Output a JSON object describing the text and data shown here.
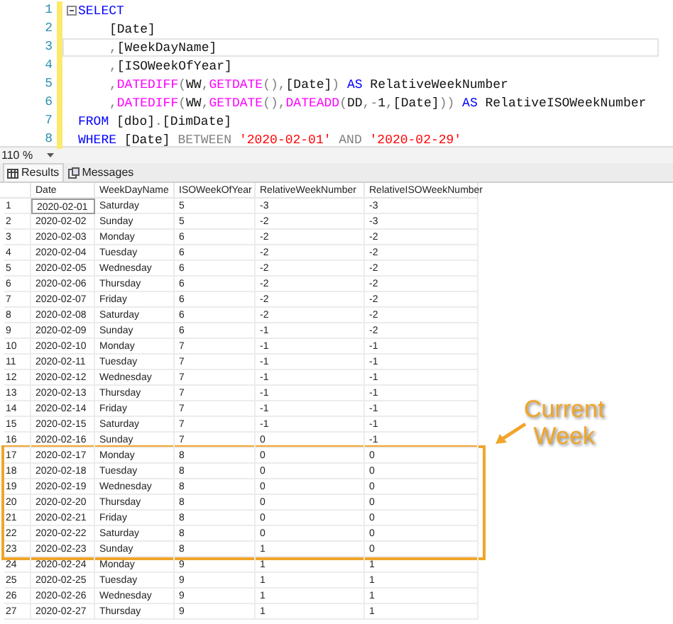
{
  "editor": {
    "lines": [
      {
        "number": "1",
        "collapsible": true,
        "indent": false,
        "current": false,
        "tokens": [
          {
            "kind": "kw",
            "text": "SELECT"
          }
        ]
      },
      {
        "number": "2",
        "collapsible": false,
        "indent": true,
        "current": false,
        "tokens": [
          {
            "kind": "id",
            "text": "[Date]"
          }
        ]
      },
      {
        "number": "3",
        "collapsible": false,
        "indent": true,
        "current": true,
        "tokens": [
          {
            "kind": "op",
            "text": ","
          },
          {
            "kind": "id",
            "text": "[WeekDayName]"
          }
        ]
      },
      {
        "number": "4",
        "collapsible": false,
        "indent": true,
        "current": false,
        "tokens": [
          {
            "kind": "op",
            "text": ","
          },
          {
            "kind": "id",
            "text": "[ISOWeekOfYear]"
          }
        ]
      },
      {
        "number": "5",
        "collapsible": false,
        "indent": true,
        "current": false,
        "tokens": [
          {
            "kind": "op",
            "text": ","
          },
          {
            "kind": "fn",
            "text": "DATEDIFF"
          },
          {
            "kind": "op",
            "text": "("
          },
          {
            "kind": "id",
            "text": "WW"
          },
          {
            "kind": "op",
            "text": ","
          },
          {
            "kind": "fn",
            "text": "GETDATE"
          },
          {
            "kind": "op",
            "text": "(),"
          },
          {
            "kind": "id",
            "text": "[Date]"
          },
          {
            "kind": "op",
            "text": ")"
          },
          {
            "kind": "kw",
            "text": " AS"
          },
          {
            "kind": "id",
            "text": " RelativeWeekNumber"
          }
        ]
      },
      {
        "number": "6",
        "collapsible": false,
        "indent": true,
        "current": false,
        "tokens": [
          {
            "kind": "op",
            "text": ","
          },
          {
            "kind": "fn",
            "text": "DATEDIFF"
          },
          {
            "kind": "op",
            "text": "("
          },
          {
            "kind": "id",
            "text": "WW"
          },
          {
            "kind": "op",
            "text": ","
          },
          {
            "kind": "fn",
            "text": "GETDATE"
          },
          {
            "kind": "op",
            "text": "(),"
          },
          {
            "kind": "fn",
            "text": "DATEADD"
          },
          {
            "kind": "op",
            "text": "("
          },
          {
            "kind": "id",
            "text": "DD"
          },
          {
            "kind": "op",
            "text": ",-"
          },
          {
            "kind": "id",
            "text": "1"
          },
          {
            "kind": "op",
            "text": ","
          },
          {
            "kind": "id",
            "text": "[Date]"
          },
          {
            "kind": "op",
            "text": "))"
          },
          {
            "kind": "kw",
            "text": " AS"
          },
          {
            "kind": "id",
            "text": " RelativeISOWeekNumber"
          }
        ]
      },
      {
        "number": "7",
        "collapsible": false,
        "indent": false,
        "current": false,
        "tokens": [
          {
            "kind": "kw",
            "text": "FROM"
          },
          {
            "kind": "id",
            "text": " [dbo]"
          },
          {
            "kind": "op",
            "text": "."
          },
          {
            "kind": "id",
            "text": "[DimDate]"
          }
        ]
      },
      {
        "number": "8",
        "collapsible": false,
        "indent": false,
        "current": false,
        "tokens": [
          {
            "kind": "kw",
            "text": "WHERE"
          },
          {
            "kind": "id",
            "text": " [Date]"
          },
          {
            "kind": "op",
            "text": " BETWEEN "
          },
          {
            "kind": "str",
            "text": "'2020-02-01'"
          },
          {
            "kind": "op",
            "text": " AND "
          },
          {
            "kind": "str",
            "text": "'2020-02-29'"
          }
        ]
      }
    ]
  },
  "zoom": {
    "value": "110 %"
  },
  "tabs": [
    {
      "label": "Results",
      "kind": "grid",
      "selected": true
    },
    {
      "label": "Messages",
      "kind": "messages",
      "selected": false
    }
  ],
  "results": {
    "columns": [
      "Date",
      "WeekDayName",
      "ISOWeekOfYear",
      "RelativeWeekNumber",
      "RelativeISOWeekNumber"
    ],
    "rows": [
      {
        "number": "1",
        "cells": [
          "2020-02-01",
          "Saturday",
          "5",
          "-3",
          "-3"
        ],
        "focused": true,
        "boxed": false
      },
      {
        "number": "2",
        "cells": [
          "2020-02-02",
          "Sunday",
          "5",
          "-2",
          "-3"
        ],
        "focused": false,
        "boxed": false
      },
      {
        "number": "3",
        "cells": [
          "2020-02-03",
          "Monday",
          "6",
          "-2",
          "-2"
        ],
        "focused": false,
        "boxed": false
      },
      {
        "number": "4",
        "cells": [
          "2020-02-04",
          "Tuesday",
          "6",
          "-2",
          "-2"
        ],
        "focused": false,
        "boxed": false
      },
      {
        "number": "5",
        "cells": [
          "2020-02-05",
          "Wednesday",
          "6",
          "-2",
          "-2"
        ],
        "focused": false,
        "boxed": false
      },
      {
        "number": "6",
        "cells": [
          "2020-02-06",
          "Thursday",
          "6",
          "-2",
          "-2"
        ],
        "focused": false,
        "boxed": false
      },
      {
        "number": "7",
        "cells": [
          "2020-02-07",
          "Friday",
          "6",
          "-2",
          "-2"
        ],
        "focused": false,
        "boxed": false
      },
      {
        "number": "8",
        "cells": [
          "2020-02-08",
          "Saturday",
          "6",
          "-2",
          "-2"
        ],
        "focused": false,
        "boxed": false
      },
      {
        "number": "9",
        "cells": [
          "2020-02-09",
          "Sunday",
          "6",
          "-1",
          "-2"
        ],
        "focused": false,
        "boxed": false
      },
      {
        "number": "10",
        "cells": [
          "2020-02-10",
          "Monday",
          "7",
          "-1",
          "-1"
        ],
        "focused": false,
        "boxed": false
      },
      {
        "number": "11",
        "cells": [
          "2020-02-11",
          "Tuesday",
          "7",
          "-1",
          "-1"
        ],
        "focused": false,
        "boxed": false
      },
      {
        "number": "12",
        "cells": [
          "2020-02-12",
          "Wednesday",
          "7",
          "-1",
          "-1"
        ],
        "focused": false,
        "boxed": false
      },
      {
        "number": "13",
        "cells": [
          "2020-02-13",
          "Thursday",
          "7",
          "-1",
          "-1"
        ],
        "focused": false,
        "boxed": false
      },
      {
        "number": "14",
        "cells": [
          "2020-02-14",
          "Friday",
          "7",
          "-1",
          "-1"
        ],
        "focused": false,
        "boxed": false
      },
      {
        "number": "15",
        "cells": [
          "2020-02-15",
          "Saturday",
          "7",
          "-1",
          "-1"
        ],
        "focused": false,
        "boxed": false
      },
      {
        "number": "16",
        "cells": [
          "2020-02-16",
          "Sunday",
          "7",
          "0",
          "-1"
        ],
        "focused": false,
        "boxed": false
      },
      {
        "number": "17",
        "cells": [
          "2020-02-17",
          "Monday",
          "8",
          "0",
          "0"
        ],
        "focused": false,
        "boxed": true
      },
      {
        "number": "18",
        "cells": [
          "2020-02-18",
          "Tuesday",
          "8",
          "0",
          "0"
        ],
        "focused": false,
        "boxed": true
      },
      {
        "number": "19",
        "cells": [
          "2020-02-19",
          "Wednesday",
          "8",
          "0",
          "0"
        ],
        "focused": false,
        "boxed": true
      },
      {
        "number": "20",
        "cells": [
          "2020-02-20",
          "Thursday",
          "8",
          "0",
          "0"
        ],
        "focused": false,
        "boxed": true
      },
      {
        "number": "21",
        "cells": [
          "2020-02-21",
          "Friday",
          "8",
          "0",
          "0"
        ],
        "focused": false,
        "boxed": true
      },
      {
        "number": "22",
        "cells": [
          "2020-02-22",
          "Saturday",
          "8",
          "0",
          "0"
        ],
        "focused": false,
        "boxed": true
      },
      {
        "number": "23",
        "cells": [
          "2020-02-23",
          "Sunday",
          "8",
          "1",
          "0"
        ],
        "focused": false,
        "boxed": true
      },
      {
        "number": "24",
        "cells": [
          "2020-02-24",
          "Monday",
          "9",
          "1",
          "1"
        ],
        "focused": false,
        "boxed": false
      },
      {
        "number": "25",
        "cells": [
          "2020-02-25",
          "Tuesday",
          "9",
          "1",
          "1"
        ],
        "focused": false,
        "boxed": false
      },
      {
        "number": "26",
        "cells": [
          "2020-02-26",
          "Wednesday",
          "9",
          "1",
          "1"
        ],
        "focused": false,
        "boxed": false
      },
      {
        "number": "27",
        "cells": [
          "2020-02-27",
          "Thursday",
          "9",
          "1",
          "1"
        ],
        "focused": false,
        "boxed": false
      }
    ]
  },
  "annotation": {
    "lines": [
      "Current",
      "Week"
    ]
  }
}
